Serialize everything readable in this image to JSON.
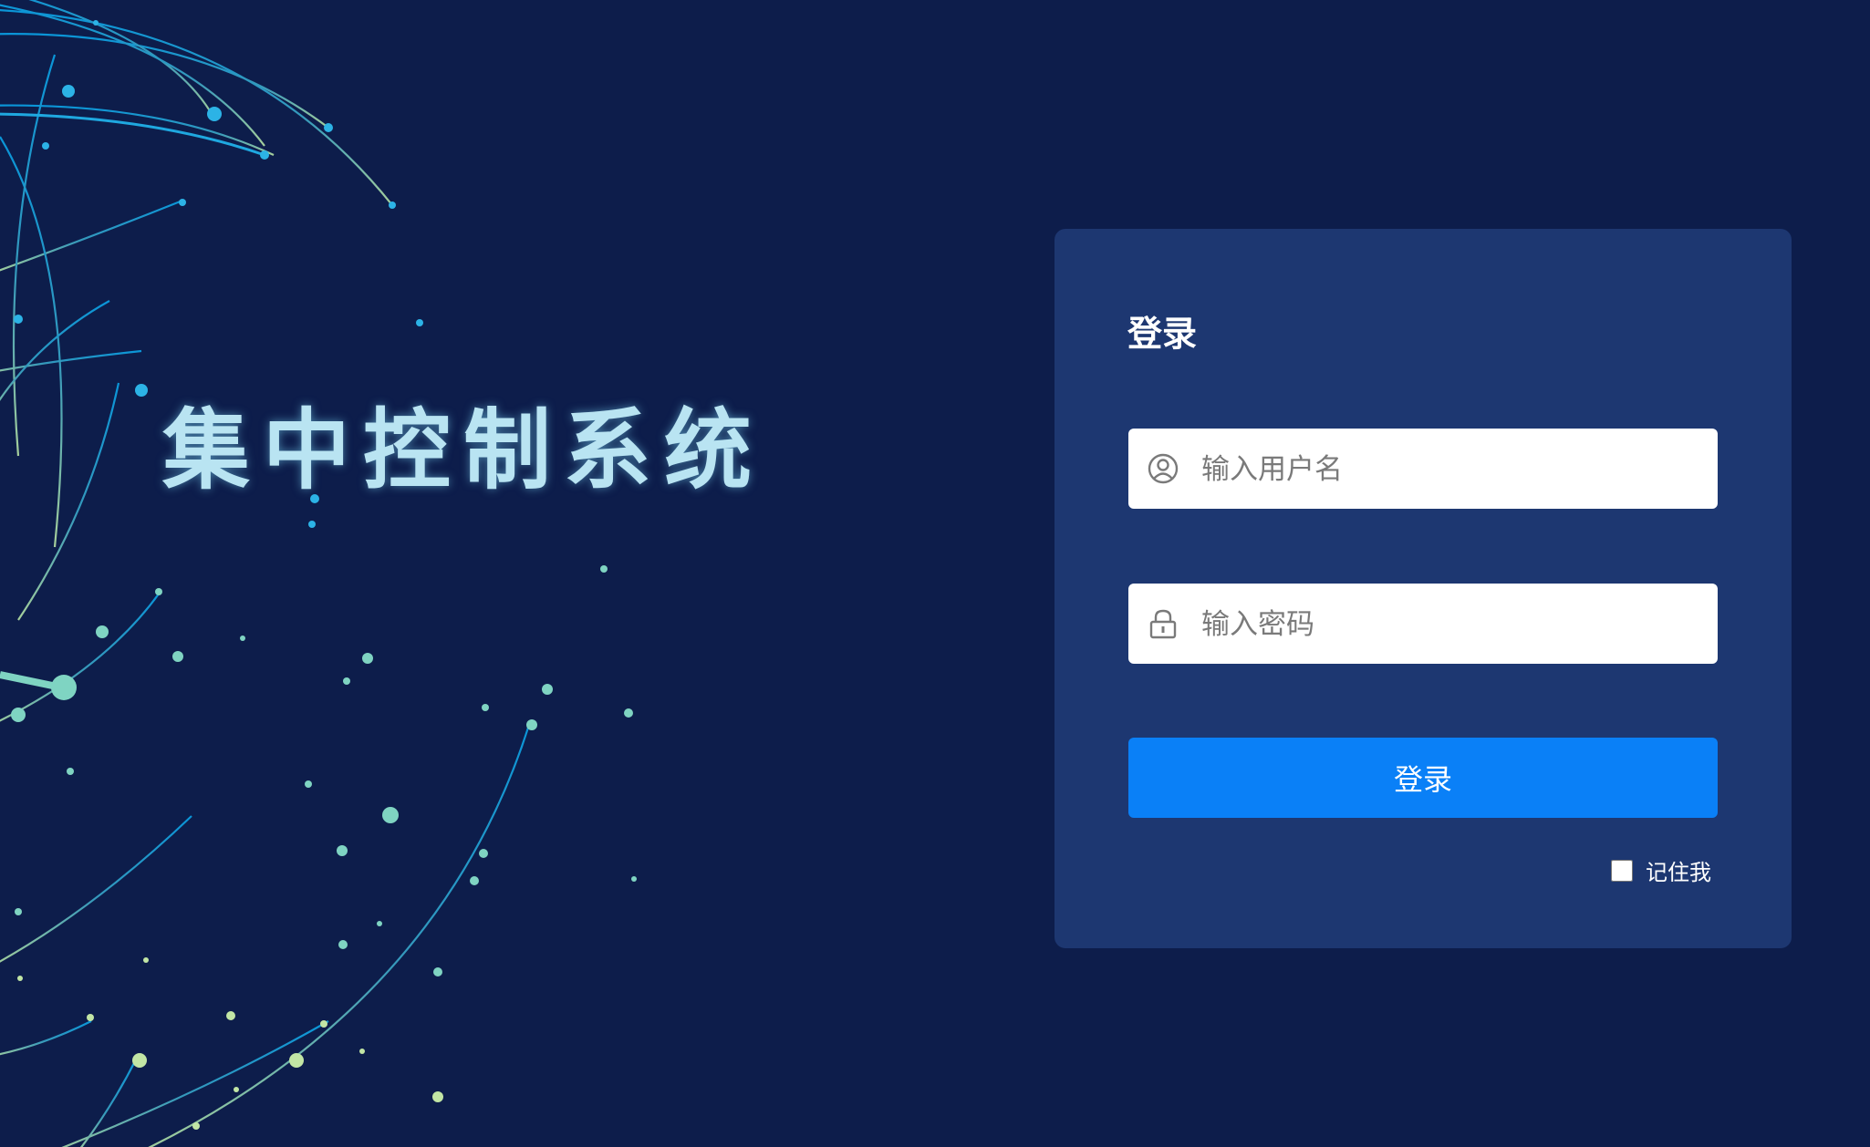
{
  "system": {
    "title": "集中控制系统"
  },
  "login": {
    "heading": "登录",
    "username_placeholder": "输入用户名",
    "password_placeholder": "输入密码",
    "submit_label": "登录",
    "remember_label": "记住我",
    "remember_checked": false
  },
  "icons": {
    "username": "user-circle-icon",
    "password": "lock-icon"
  },
  "colors": {
    "background": "#0d1d4b",
    "card": "#1d3771",
    "primary_button": "#0a80f7",
    "title_glow": "#b9e4f2"
  }
}
